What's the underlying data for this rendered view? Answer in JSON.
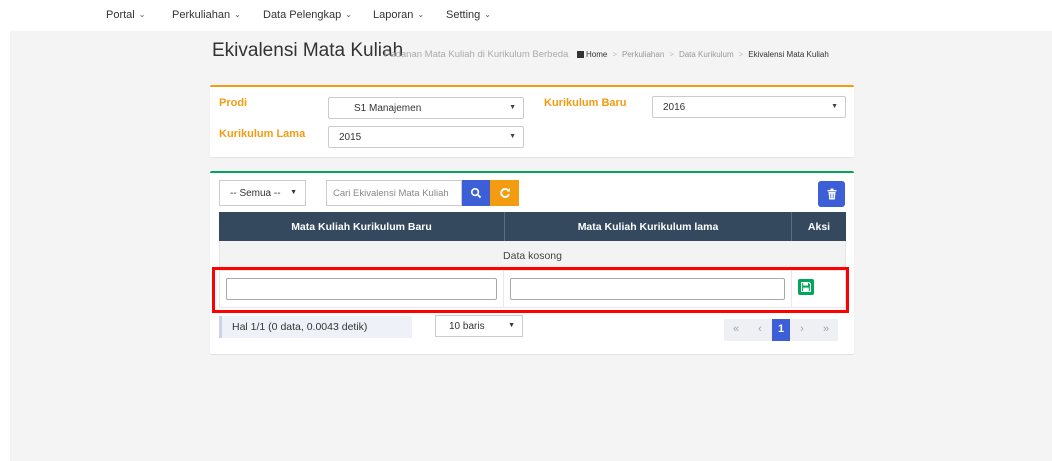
{
  "nav": {
    "items": [
      {
        "label": "Portal"
      },
      {
        "label": "Perkuliahan"
      },
      {
        "label": "Data Pelengkap"
      },
      {
        "label": "Laporan"
      },
      {
        "label": "Setting"
      }
    ],
    "chevron": "⌄"
  },
  "header": {
    "title": "Ekivalensi Mata Kuliah",
    "subtitle": "Padanan Mata Kuliah di Kurikulum Berbeda",
    "breadcrumb": {
      "home": "Home",
      "sep": ">",
      "items": [
        "Perkuliahan",
        "Data Kurikulum",
        "Ekivalensi Mata Kuliah"
      ]
    }
  },
  "filters": {
    "prodi_label": "Prodi",
    "prodi_value": "S1 Manajemen",
    "kurikulum_lama_label": "Kurikulum Lama",
    "kurikulum_lama_value": "2015",
    "kurikulum_baru_label": "Kurikulum Baru",
    "kurikulum_baru_value": "2016"
  },
  "toolbar": {
    "filter_value": "-- Semua --",
    "search_placeholder": "Cari Ekivalensi Mata Kuliah"
  },
  "table": {
    "columns": [
      "Mata Kuliah Kurikulum Baru",
      "Mata Kuliah Kurikulum lama",
      "Aksi"
    ],
    "empty_text": "Data kosong"
  },
  "footer": {
    "info": "Hal 1/1 (0 data, 0.0043 detik)",
    "rows_per_page": "10 baris",
    "pagination": [
      "«",
      "‹",
      "1",
      "›",
      "»"
    ],
    "current_page": 1
  },
  "colors": {
    "accent_orange": "#f39c12",
    "accent_green": "#00a65a",
    "primary_blue": "#3c5fd8",
    "table_header": "#34495e",
    "highlight_red": "#ff0000"
  }
}
